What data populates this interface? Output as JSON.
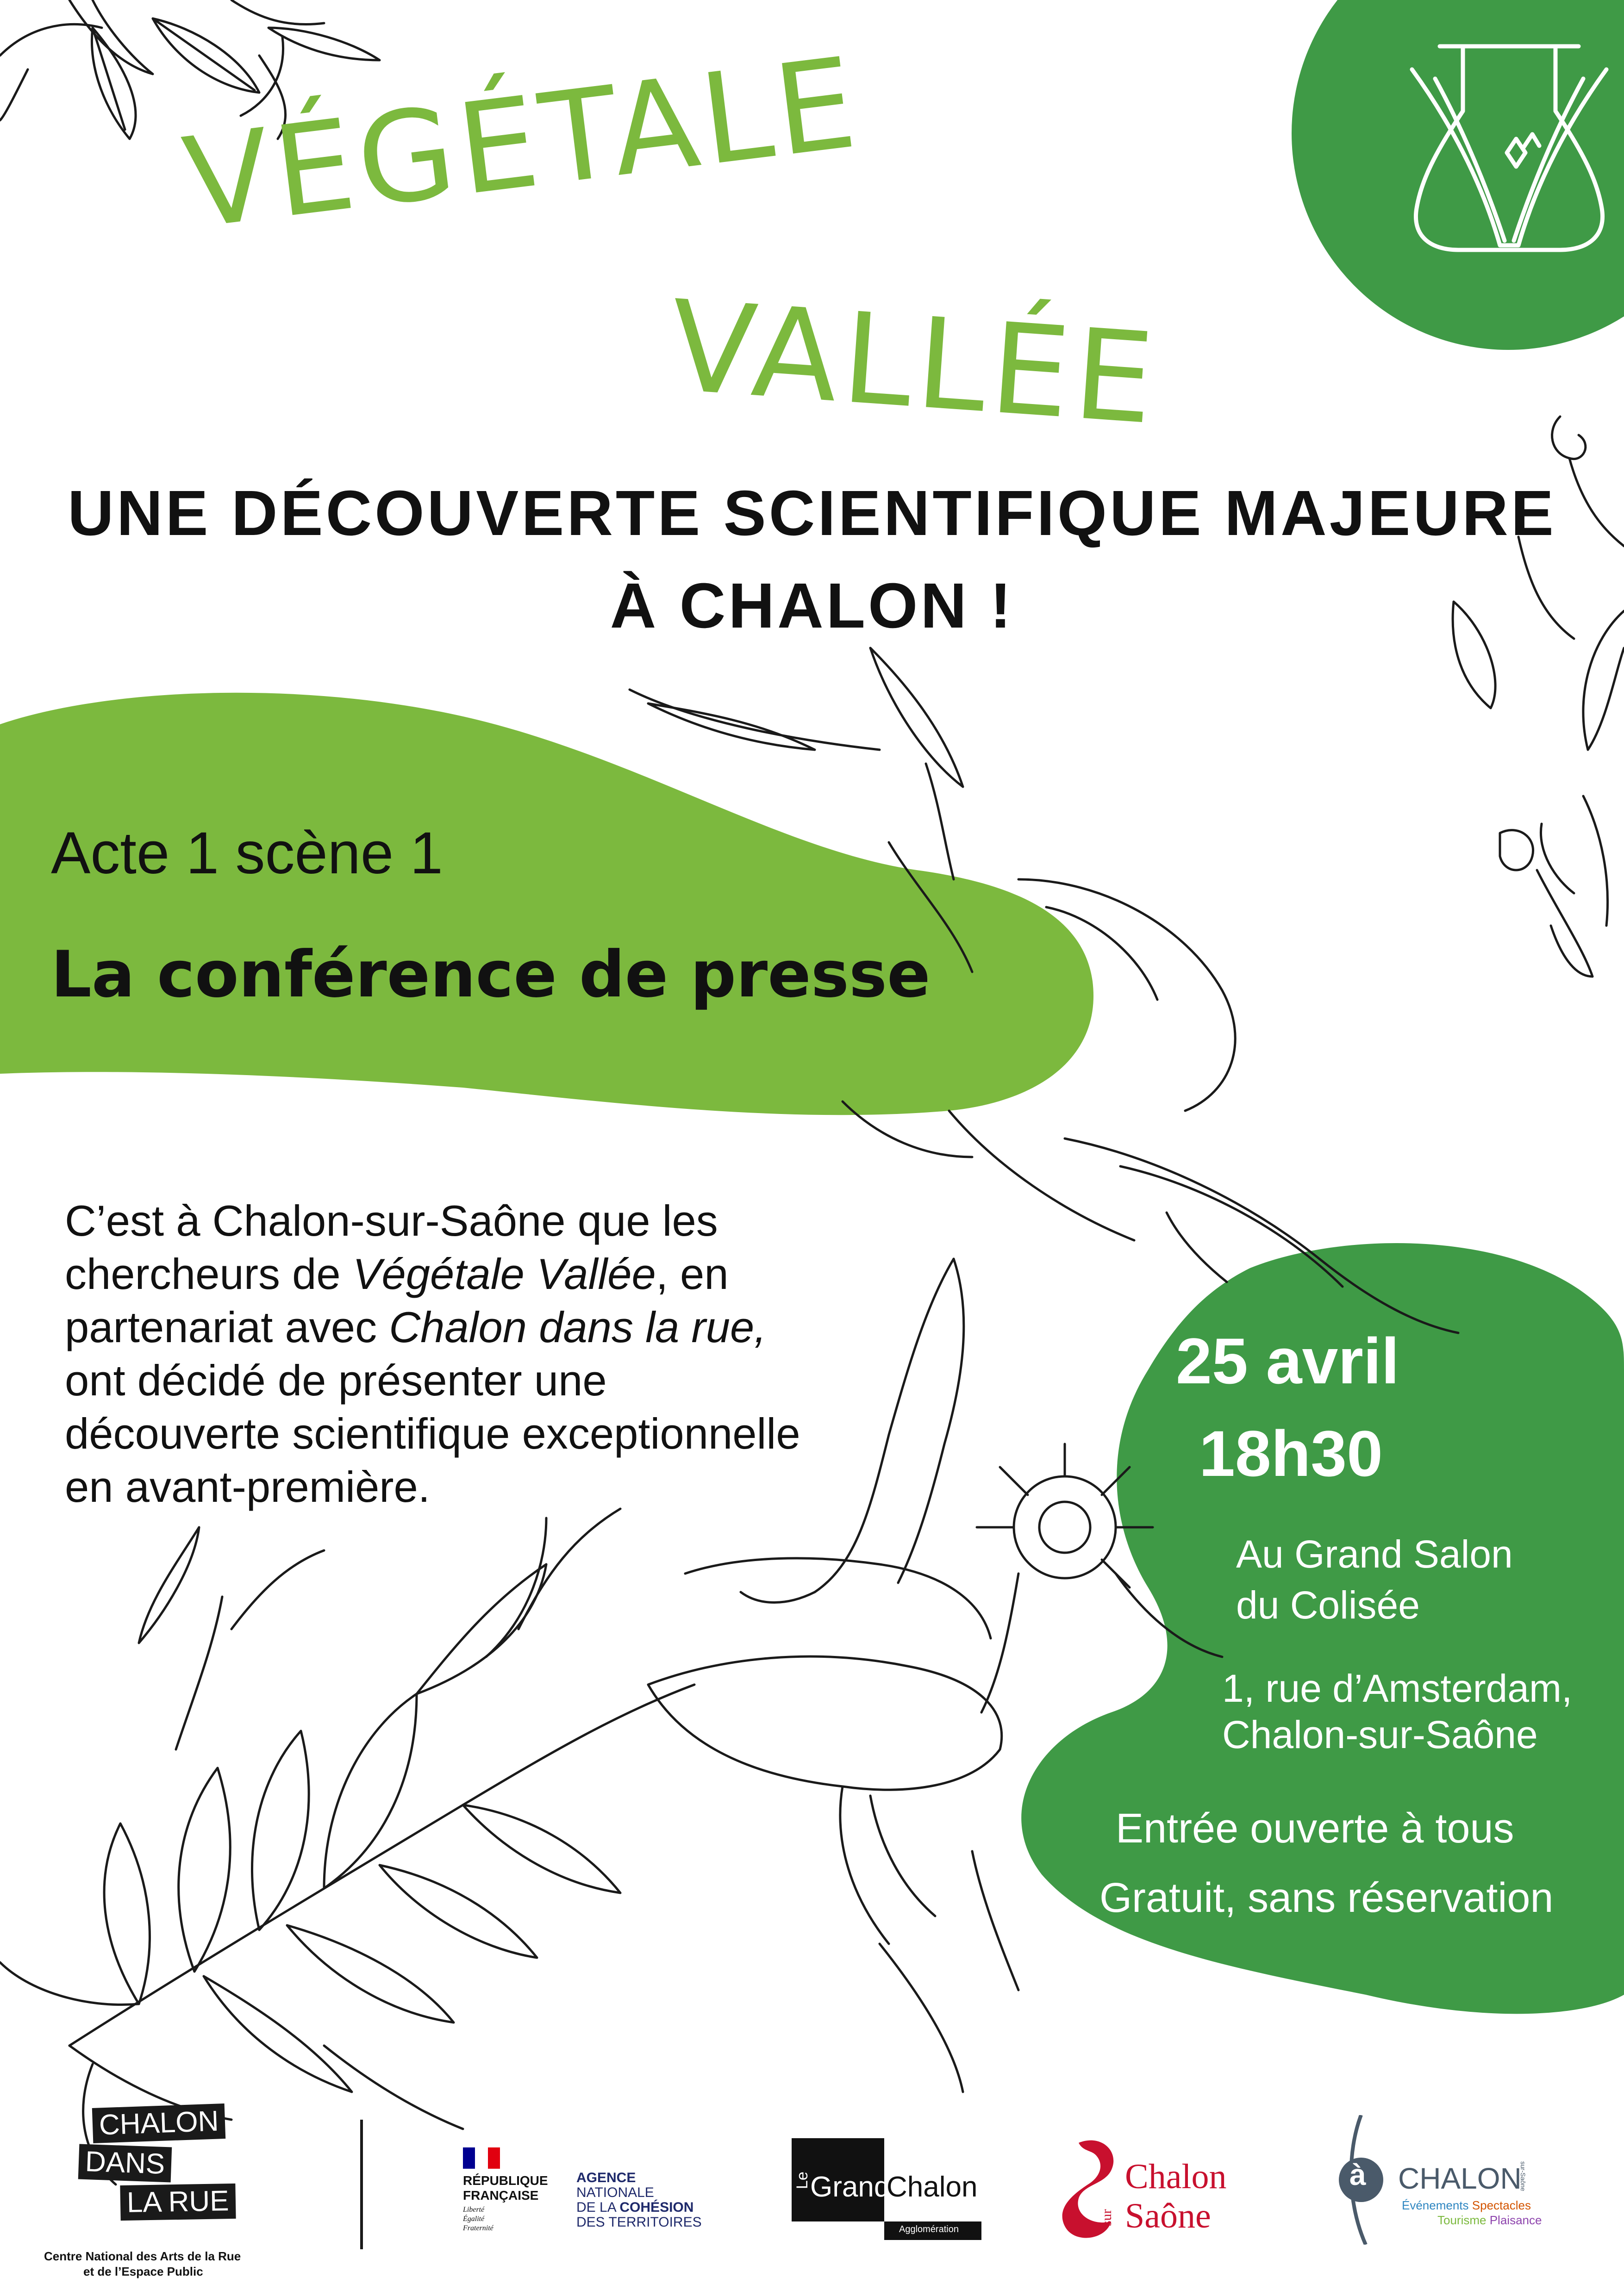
{
  "colors": {
    "light_green": "#7cb93e",
    "dark_green": "#3f9a46",
    "title_green": "#7cb93e",
    "red": "#c8102e",
    "text": "#1a1a1a"
  },
  "title": {
    "line1": "VÉGÉTALE",
    "line2": "VALLÉE"
  },
  "headline": {
    "line1": "UNE DÉCOUVERTE SCIENTIFIQUE MAJEURE",
    "line2": "À CHALON !"
  },
  "act": {
    "scene": "Acte 1 scène 1",
    "event": "La conférence de presse"
  },
  "intro": {
    "l1": "C’est à Chalon-sur-Saône que les",
    "l2a": "chercheurs de ",
    "l2b": "Végétale Vallée",
    "l2c": ", en",
    "l3a": "partenariat avec ",
    "l3b": "Chalon dans la rue,",
    "l4": "ont décidé de présenter une",
    "l5": "découverte scientifique exceptionnelle",
    "l6": "en avant-première."
  },
  "event_info": {
    "date": "25 avril",
    "time": "18h30",
    "venue_l1": "Au Grand Salon",
    "venue_l2": "du Colisée",
    "address_l1": "1, rue d’Amsterdam,",
    "address_l2": "Chalon-sur-Saône",
    "entry": "Entrée ouverte à tous",
    "price": "Gratuit, sans réservation"
  },
  "logos": {
    "cdlr": {
      "w1": "CHALON",
      "w2": "DANS",
      "w3": "LA RUE",
      "cap1": "Centre National des Arts de la Rue",
      "cap2": "et de l’Espace Public"
    },
    "rf": {
      "l1": "RÉPUBLIQUE",
      "l2": "FRANÇAISE",
      "m1": "Liberté",
      "m2": "Égalité",
      "m3": "Fraternité"
    },
    "anct": {
      "l1": "AGENCE",
      "l2": "NATIONALE",
      "l3": "DE LA ",
      "l3b": "COHÉSION",
      "l4": "DES TERRITOIRES"
    },
    "grand_chalon": {
      "le": "Le",
      "grand": "Grand",
      "chalon": "Chalon",
      "sub": "Agglomération"
    },
    "css": {
      "l1": "Chalon",
      "sur": "sur",
      "l2": "Saône"
    },
    "a_chalon": {
      "a": "à",
      "name": "CHALON",
      "side": "sur-Saône",
      "t1": "Événements",
      "t2": "Spectacles",
      "t3": "Tourisme",
      "t4": "Plaisance"
    }
  }
}
